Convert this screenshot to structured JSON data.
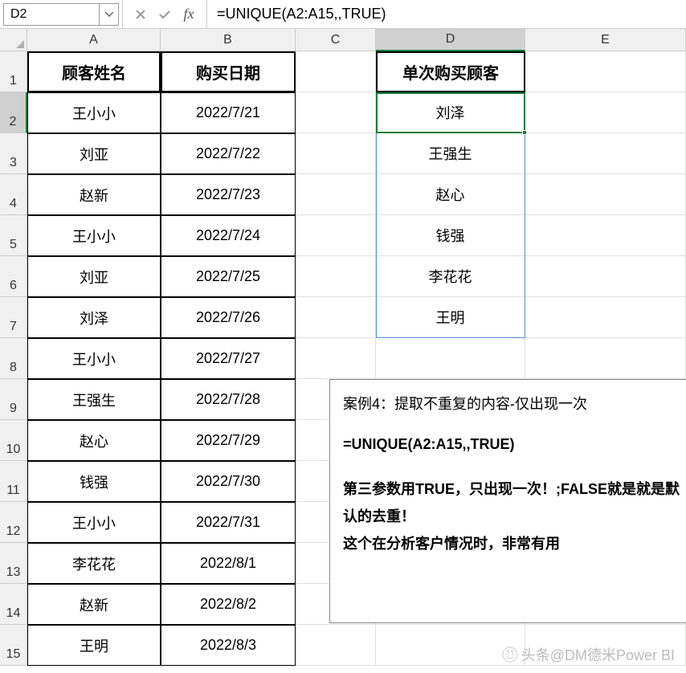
{
  "name_box": "D2",
  "formula": "=UNIQUE(A2:A15,,TRUE)",
  "columns": [
    "A",
    "B",
    "C",
    "D",
    "E"
  ],
  "col_widths": {
    "A": 166,
    "B": 168,
    "C": 100,
    "D": 186,
    "E": 200
  },
  "active_col": "D",
  "active_row": 2,
  "row_count": 15,
  "headers": {
    "A": "顾客姓名",
    "B": "购买日期",
    "D": "单次购买顾客"
  },
  "data_A": [
    "王小小",
    "刘亚",
    "赵新",
    "王小小",
    "刘亚",
    "刘泽",
    "王小小",
    "王强生",
    "赵心",
    "钱强",
    "王小小",
    "李花花",
    "赵新",
    "王明"
  ],
  "data_B": [
    "2022/7/21",
    "2022/7/22",
    "2022/7/23",
    "2022/7/24",
    "2022/7/25",
    "2022/7/26",
    "2022/7/27",
    "2022/7/28",
    "2022/7/29",
    "2022/7/30",
    "2022/7/31",
    "2022/8/1",
    "2022/8/2",
    "2022/8/3"
  ],
  "data_D": [
    "刘泽",
    "王强生",
    "赵心",
    "钱强",
    "李花花",
    "王明"
  ],
  "textbox": {
    "title": "案例4：提取不重复的内容-仅出现一次",
    "formula": "=UNIQUE(A2:A15,,TRUE)",
    "note1": "第三参数用TRUE，只出现一次！;FALSE就是就是默认的去重！",
    "note2": "这个在分析客户情况时，非常有用"
  },
  "watermark": "头条@DM德米Power BI"
}
